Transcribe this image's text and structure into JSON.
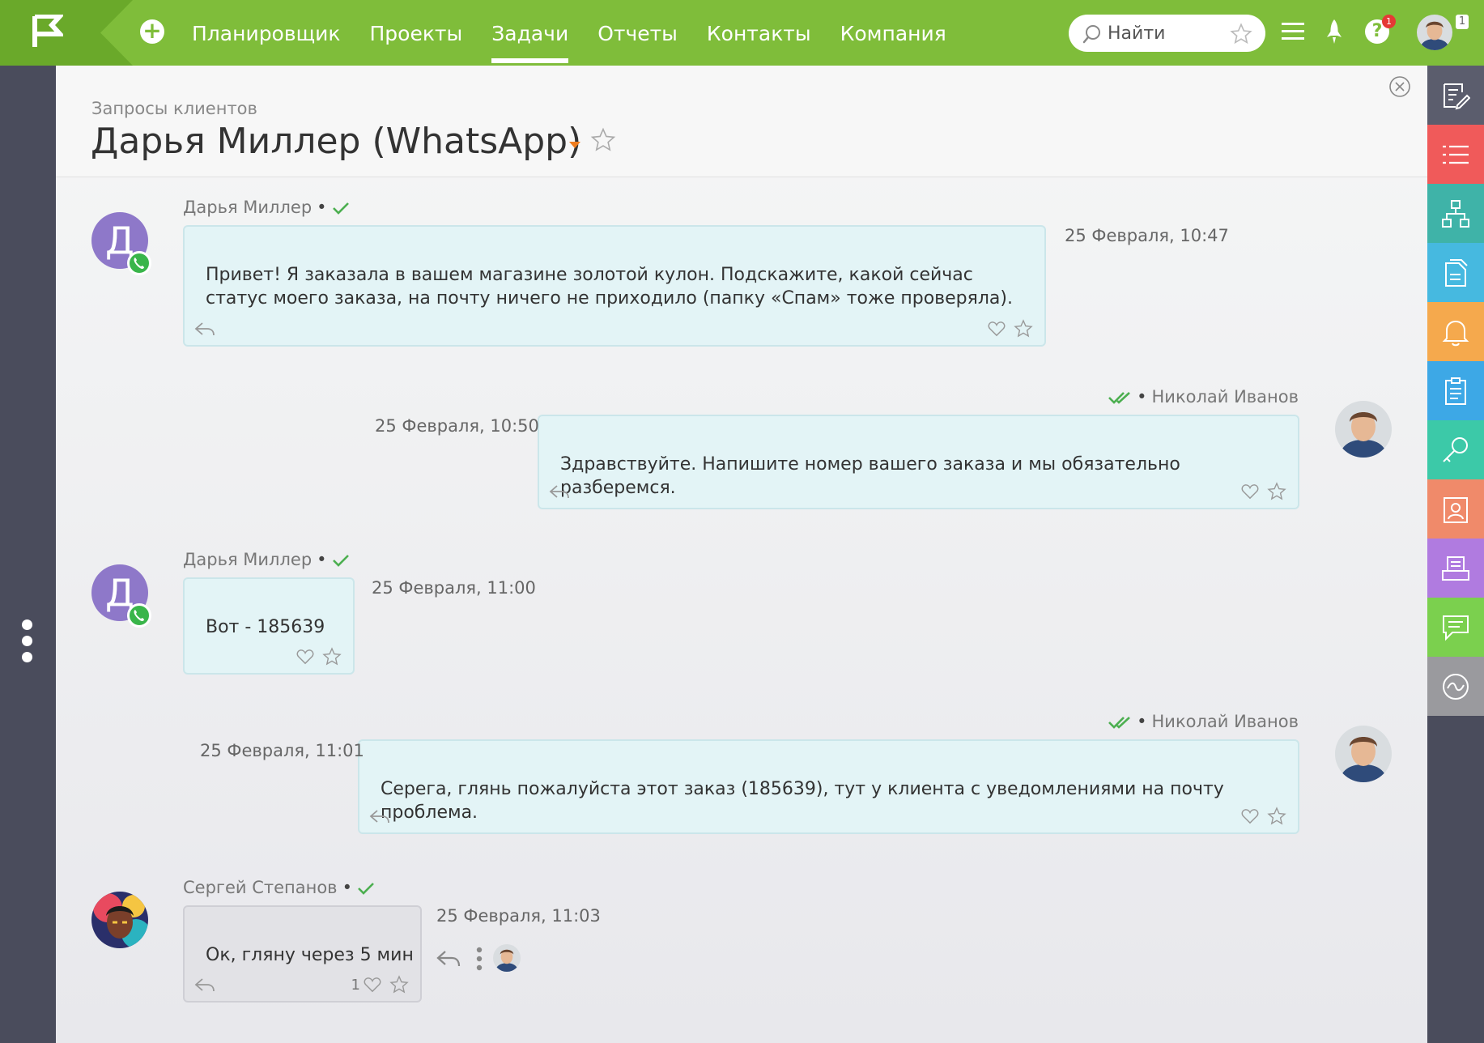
{
  "nav": {
    "items": [
      "Планировщик",
      "Проекты",
      "Задачи",
      "Отчеты",
      "Контакты",
      "Компания"
    ],
    "active_index": 2
  },
  "search": {
    "placeholder": "Найти"
  },
  "topbar": {
    "help_badge": "1",
    "user_count": "1"
  },
  "page": {
    "breadcrumb": "Запросы клиентов",
    "title": "Дарья Миллер (WhatsApp)"
  },
  "messages": [
    {
      "author": "Дарья Миллер",
      "avatar_letter": "Д",
      "time": "25 Февраля, 10:47",
      "text": "Привет! Я заказала в вашем магазине золотой кулон. Подскажите, какой сейчас статус моего заказа, на почту ничего не приходило (папку «Спам» тоже проверяла).",
      "side": "left"
    },
    {
      "author": "Николай Иванов",
      "time": "25 Февраля, 10:50",
      "text": "Здравствуйте. Напишите номер вашего заказа и мы обязательно разберемся.",
      "side": "right"
    },
    {
      "author": "Дарья Миллер",
      "avatar_letter": "Д",
      "time": "25 Февраля, 11:00",
      "text": "Вот - 185639",
      "side": "left"
    },
    {
      "author": "Николай Иванов",
      "time": "25 Февраля, 11:01",
      "text": "Серега, глянь пожалуйста этот заказ (185639), тут у клиента с уведомлениями на почту проблема.",
      "side": "right"
    },
    {
      "author": "Сергей Степанов",
      "time": "25 Февраля, 11:03",
      "text": "Ок, гляну через 5 мин",
      "likes": "1",
      "side": "left"
    }
  ],
  "colors": {
    "brand_green": "#7fbd3a",
    "bubble_bg": "#e3f4f6",
    "whatsapp": "#39b54a",
    "side_buttons": [
      "#5b5d6d",
      "#f05a5a",
      "#3fb3a8",
      "#46b9e0",
      "#f5a94d",
      "#3da8e6",
      "#3cc9a8",
      "#f08a6a",
      "#b07be0",
      "#7bd04e",
      "#9a9a9e"
    ]
  },
  "side_icons": [
    "edit-list-icon",
    "list-icon",
    "hierarchy-icon",
    "documents-icon",
    "bell-icon",
    "clipboard-icon",
    "key-icon",
    "contact-card-icon",
    "inbox-icon",
    "chat-icon",
    "wave-icon"
  ]
}
